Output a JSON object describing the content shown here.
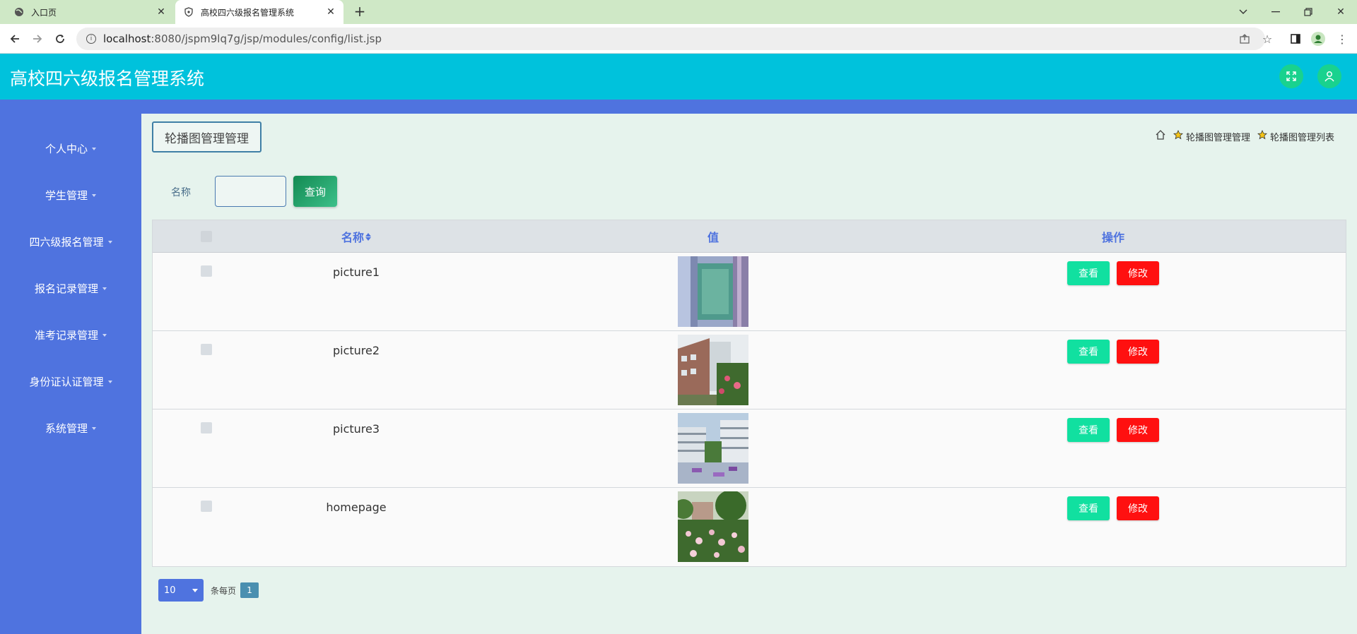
{
  "browser": {
    "tabs": [
      {
        "title": "入口页"
      },
      {
        "title": "高校四六级报名管理系统"
      }
    ],
    "url_host": "localhost",
    "url_rest": ":8080/jspm9lq7g/jsp/modules/config/list.jsp"
  },
  "app": {
    "title": "高校四六级报名管理系统"
  },
  "sidebar": {
    "items": [
      {
        "label": "个人中心"
      },
      {
        "label": "学生管理"
      },
      {
        "label": "四六级报名管理"
      },
      {
        "label": "报名记录管理"
      },
      {
        "label": "准考记录管理"
      },
      {
        "label": "身份证认证管理"
      },
      {
        "label": "系统管理"
      }
    ]
  },
  "page": {
    "title": "轮播图管理管理",
    "breadcrumb": [
      "轮播图管理管理",
      "轮播图管理列表"
    ]
  },
  "search": {
    "label": "名称",
    "value": "",
    "button": "查询"
  },
  "table": {
    "headers": {
      "name": "名称",
      "value": "值",
      "ops": "操作"
    },
    "rows": [
      {
        "name": "picture1",
        "view": "查看",
        "edit": "修改"
      },
      {
        "name": "picture2",
        "view": "查看",
        "edit": "修改"
      },
      {
        "name": "picture3",
        "view": "查看",
        "edit": "修改"
      },
      {
        "name": "homepage",
        "view": "查看",
        "edit": "修改"
      }
    ]
  },
  "pager": {
    "page_size": "10",
    "per_page_label": "条每页",
    "current_page": "1"
  },
  "colors": {
    "header": "#00c2dc",
    "sidebar": "#4f73df",
    "view_button": "#11e0a0",
    "edit_button": "#ff1010"
  }
}
